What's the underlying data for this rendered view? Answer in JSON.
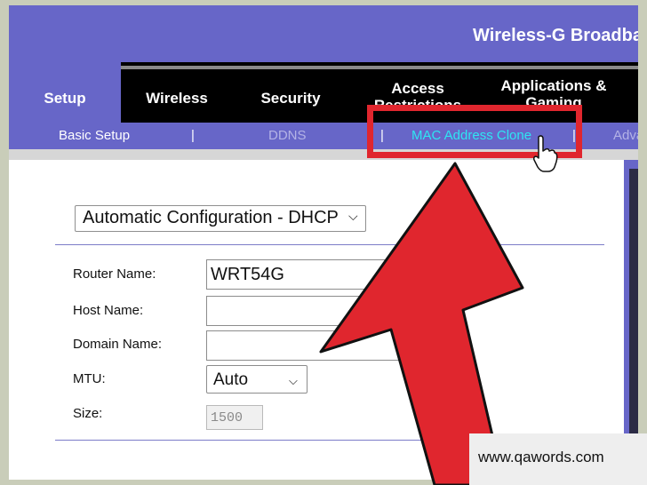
{
  "banner": {
    "title": "Wireless-G Broadband"
  },
  "nav": {
    "tabs": [
      {
        "label": "Setup"
      },
      {
        "label": "Wireless"
      },
      {
        "label": "Security"
      },
      {
        "label": "Access Restrictions"
      },
      {
        "label": "Applications & Gaming"
      }
    ]
  },
  "subnav": {
    "items": [
      {
        "label": "Basic Setup"
      },
      {
        "label": "DDNS"
      },
      {
        "label": "MAC Address Clone"
      },
      {
        "label": "Advanced Routing"
      }
    ],
    "separator": "|"
  },
  "form": {
    "connection_type": "Automatic Configuration - DHCP",
    "router_name": {
      "label": "Router Name:",
      "value": "WRT54G"
    },
    "host_name": {
      "label": "Host Name:",
      "value": ""
    },
    "domain_name": {
      "label": "Domain Name:",
      "value": ""
    },
    "mtu": {
      "label": "MTU:",
      "value": "Auto"
    },
    "size": {
      "label": "Size:",
      "value": "1500"
    }
  },
  "watermark": {
    "text": "www.qawords.com"
  },
  "colors": {
    "accent_purple": "#6766c8",
    "nav_black": "#000000",
    "highlight_red": "#e0262e",
    "active_sublink": "#2ee6f2"
  }
}
